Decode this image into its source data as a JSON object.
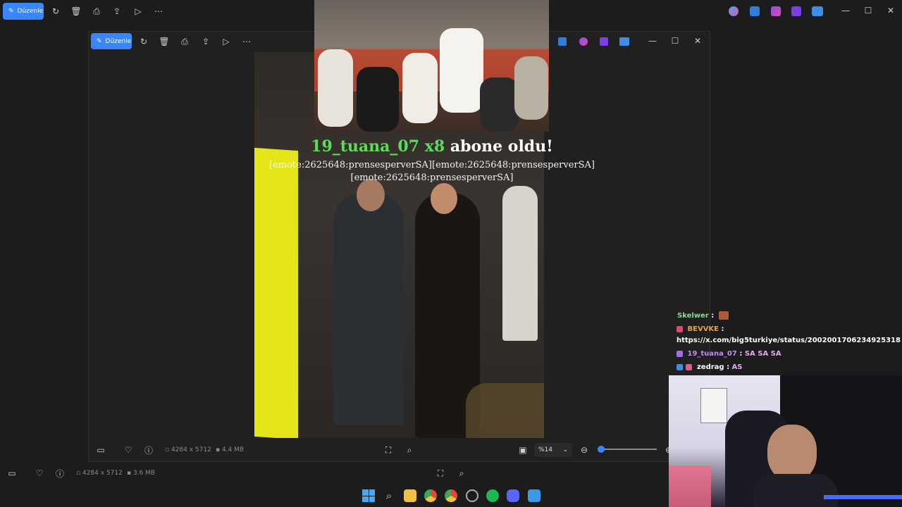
{
  "outer_toolbar": {
    "edit_label": "Düzenle",
    "status": {
      "dimensions": "4284 x 5712",
      "size": "3.6 MB"
    }
  },
  "inner_window": {
    "edit_label": "Düzenle",
    "status": {
      "dimensions": "4284 x 5712",
      "size": "4.4 MB",
      "zoom": "%14"
    },
    "zoom_level": 0.14
  },
  "alert": {
    "user": "19_tuana_07 x8",
    "action": "abone oldu!",
    "message_line1": "[emote:2625648:prensesperverSA][emote:2625648:prensesperverSA]",
    "message_line2": "[emote:2625648:prensesperverSA]",
    "user_color": "#5bdc5b"
  },
  "chat": [
    {
      "user": "Skelwer",
      "sep": ":",
      "text": "",
      "color": "#8fd6a0"
    },
    {
      "user": "BEVVKE",
      "sep": ":",
      "text": "",
      "color": "#f0a030"
    },
    {
      "user": "",
      "sep": "",
      "text": "https://x.com/big5turkiye/status/2002001706234925318",
      "color": "#ffffff"
    },
    {
      "user": "19_tuana_07",
      "sep": ":",
      "text": "SA SA SA",
      "color": "#c08cf0"
    },
    {
      "user": "zedrag",
      "sep": ":",
      "text": "AS",
      "color": "#ffffff"
    }
  ],
  "colors": {
    "accent": "#3a86ff",
    "background": "#1c1c1c"
  }
}
